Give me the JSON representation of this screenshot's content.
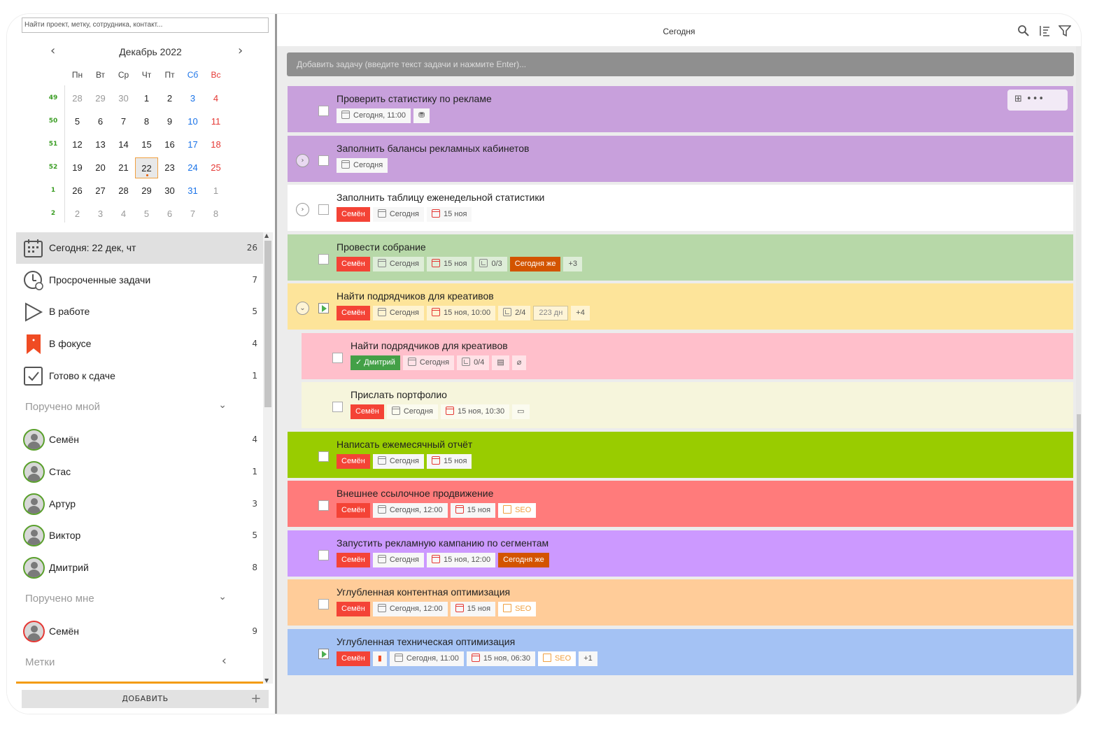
{
  "search": {
    "placeholder": "Найти проект, метку, сотрудника, контакт..."
  },
  "calendar": {
    "title": "Декабрь 2022",
    "weekdays": [
      "Пн",
      "Вт",
      "Ср",
      "Чт",
      "Пт",
      "Сб",
      "Вс"
    ],
    "weeks": [
      {
        "num": "49",
        "days": [
          "28",
          "29",
          "30",
          "1",
          "2",
          "3",
          "4"
        ]
      },
      {
        "num": "50",
        "days": [
          "5",
          "6",
          "7",
          "8",
          "9",
          "10",
          "11"
        ]
      },
      {
        "num": "51",
        "days": [
          "12",
          "13",
          "14",
          "15",
          "16",
          "17",
          "18"
        ]
      },
      {
        "num": "52",
        "days": [
          "19",
          "20",
          "21",
          "22",
          "23",
          "24",
          "25"
        ]
      },
      {
        "num": "1",
        "days": [
          "26",
          "27",
          "28",
          "29",
          "30",
          "31",
          "1"
        ]
      },
      {
        "num": "2",
        "days": [
          "2",
          "3",
          "4",
          "5",
          "6",
          "7",
          "8"
        ]
      }
    ]
  },
  "nav": {
    "today": {
      "label": "Сегодня: 22 дек, чт",
      "count": "26"
    },
    "overdue": {
      "label": "Просроченные задачи",
      "count": "7"
    },
    "inwork": {
      "label": "В работе",
      "count": "5"
    },
    "focus": {
      "label": "В фокусе",
      "count": "4"
    },
    "ready": {
      "label": "Готово к сдаче",
      "count": "1"
    },
    "assigned_by_me": {
      "label": "Поручено мной"
    },
    "people_by_me": [
      {
        "name": "Семён",
        "count": "4"
      },
      {
        "name": "Стас",
        "count": "1"
      },
      {
        "name": "Артур",
        "count": "3"
      },
      {
        "name": "Виктор",
        "count": "5"
      },
      {
        "name": "Дмитрий",
        "count": "8"
      }
    ],
    "assigned_to_me": {
      "label": "Поручено мне"
    },
    "people_to_me": [
      {
        "name": "Семён",
        "count": "9"
      }
    ],
    "tags_section": {
      "label": "Метки"
    }
  },
  "add_button": {
    "label": "ДОБАВИТЬ",
    "plus": "+"
  },
  "header": {
    "title": "Сегодня"
  },
  "add_task": {
    "placeholder": "Добавить задачу (введите текст задачи и нажмите Enter)..."
  },
  "tasks": [
    {
      "title": "Проверить статистику по рекламе",
      "tags": [
        "Сегодня, 11:00"
      ]
    },
    {
      "title": "Заполнить балансы рекламных кабинетов",
      "tags": [
        "Сегодня"
      ]
    },
    {
      "title": "Заполнить таблицу еженедельной статистики",
      "tags": [
        "Семён",
        "Сегодня",
        "15 ноя"
      ]
    },
    {
      "title": "Провести собрание",
      "tags": [
        "Семён",
        "Сегодня",
        "15 ноя",
        "0/3",
        "Сегодня же",
        "+3"
      ]
    },
    {
      "title": "Найти подрядчиков для креативов",
      "tags": [
        "Семён",
        "Сегодня",
        "15 ноя, 10:00",
        "2/4",
        "223 дн",
        "+4"
      ]
    },
    {
      "title": "Найти подрядчиков для креативов",
      "tags": [
        "Дмитрий",
        "Сегодня",
        "0/4"
      ]
    },
    {
      "title": "Прислать портфолио",
      "tags": [
        "Семён",
        "Сегодня",
        "15 ноя, 10:30"
      ]
    },
    {
      "title": "Написать ежемесячный отчёт",
      "tags": [
        "Семён",
        "Сегодня",
        "15 ноя"
      ]
    },
    {
      "title": "Внешнее ссылочное продвижение",
      "tags": [
        "Семён",
        "Сегодня, 12:00",
        "15 ноя",
        "SEO"
      ]
    },
    {
      "title": "Запустить рекламную кампанию по сегментам",
      "tags": [
        "Семён",
        "Сегодня",
        "15 ноя, 12:00",
        "Сегодня же"
      ]
    },
    {
      "title": "Углубленная контентная оптимизация",
      "tags": [
        "Семён",
        "Сегодня, 12:00",
        "15 ноя",
        "SEO"
      ]
    },
    {
      "title": "Углубленная техническая оптимизация",
      "tags": [
        "Семён",
        "Сегодня, 11:00",
        "15 ноя, 06:30",
        "SEO",
        "+1"
      ]
    }
  ],
  "task_tools": {
    "more": "•••"
  },
  "colors": {
    "purple": "#c8a0dc",
    "white": "#ffffff",
    "green_soft": "#b7d8a8",
    "yellow": "#fde49a",
    "pink": "#ffbfcb",
    "cream": "#f6f5dc",
    "lime": "#99cc00",
    "coral": "#ff7b7b",
    "violet": "#cc99ff",
    "peach": "#ffcc99",
    "blue": "#a4c2f4",
    "accent": "#f39c12",
    "assignee_red": "#f44336"
  }
}
